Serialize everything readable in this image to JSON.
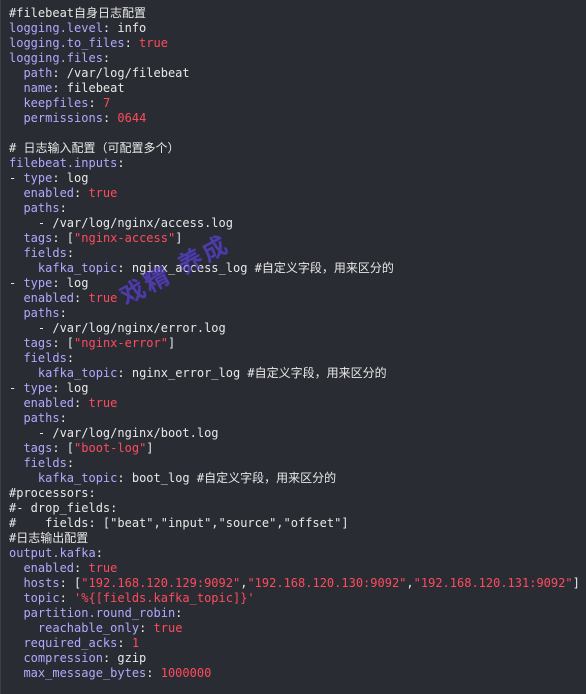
{
  "colors": {
    "background": "#2a2c33",
    "key": "#b2a8ff",
    "text": "#e8e8e8",
    "literal_red": "#ff4b5c",
    "watermark": "#6a4cff"
  },
  "lines": [
    {
      "segments": [
        {
          "t": "#filebeat自身日志配置",
          "s": "c"
        }
      ]
    },
    {
      "segments": [
        {
          "t": "logging.level",
          "s": "k"
        },
        {
          "t": ": info",
          "s": "p"
        }
      ]
    },
    {
      "segments": [
        {
          "t": "logging.to_files",
          "s": "k"
        },
        {
          "t": ": ",
          "s": "p"
        },
        {
          "t": "true",
          "s": "r"
        }
      ]
    },
    {
      "segments": [
        {
          "t": "logging.files",
          "s": "k"
        },
        {
          "t": ":",
          "s": "p"
        }
      ]
    },
    {
      "segments": [
        {
          "t": "  ",
          "s": "p"
        },
        {
          "t": "path",
          "s": "k"
        },
        {
          "t": ": /var/log/filebeat",
          "s": "p"
        }
      ]
    },
    {
      "segments": [
        {
          "t": "  ",
          "s": "p"
        },
        {
          "t": "name",
          "s": "k"
        },
        {
          "t": ": filebeat",
          "s": "p"
        }
      ]
    },
    {
      "segments": [
        {
          "t": "  ",
          "s": "p"
        },
        {
          "t": "keepfiles",
          "s": "k"
        },
        {
          "t": ": ",
          "s": "p"
        },
        {
          "t": "7",
          "s": "r"
        }
      ]
    },
    {
      "segments": [
        {
          "t": "  ",
          "s": "p"
        },
        {
          "t": "permissions",
          "s": "k"
        },
        {
          "t": ": ",
          "s": "p"
        },
        {
          "t": "0644",
          "s": "r"
        }
      ]
    },
    {
      "segments": [
        {
          "t": "",
          "s": "p"
        }
      ]
    },
    {
      "segments": [
        {
          "t": "# 日志输入配置（可配置多个）",
          "s": "c"
        }
      ]
    },
    {
      "segments": [
        {
          "t": "filebeat.inputs",
          "s": "k"
        },
        {
          "t": ":",
          "s": "p"
        }
      ]
    },
    {
      "segments": [
        {
          "t": "- ",
          "s": "p"
        },
        {
          "t": "type",
          "s": "k"
        },
        {
          "t": ": log",
          "s": "p"
        }
      ]
    },
    {
      "segments": [
        {
          "t": "  ",
          "s": "p"
        },
        {
          "t": "enabled",
          "s": "k"
        },
        {
          "t": ": ",
          "s": "p"
        },
        {
          "t": "true",
          "s": "r"
        }
      ]
    },
    {
      "segments": [
        {
          "t": "  ",
          "s": "p"
        },
        {
          "t": "paths",
          "s": "k"
        },
        {
          "t": ":",
          "s": "p"
        }
      ]
    },
    {
      "segments": [
        {
          "t": "    - /var/log/nginx/access.log",
          "s": "p"
        }
      ]
    },
    {
      "segments": [
        {
          "t": "  ",
          "s": "p"
        },
        {
          "t": "tags",
          "s": "k"
        },
        {
          "t": ": [",
          "s": "p"
        },
        {
          "t": "\"nginx-access\"",
          "s": "r"
        },
        {
          "t": "]",
          "s": "p"
        }
      ]
    },
    {
      "segments": [
        {
          "t": "  ",
          "s": "p"
        },
        {
          "t": "fields",
          "s": "k"
        },
        {
          "t": ":",
          "s": "p"
        }
      ]
    },
    {
      "segments": [
        {
          "t": "    ",
          "s": "p"
        },
        {
          "t": "kafka_topic",
          "s": "k"
        },
        {
          "t": ": nginx_access_log #自定义字段，用来区分的",
          "s": "p"
        }
      ]
    },
    {
      "segments": [
        {
          "t": "- ",
          "s": "p"
        },
        {
          "t": "type",
          "s": "k"
        },
        {
          "t": ": log",
          "s": "p"
        }
      ]
    },
    {
      "segments": [
        {
          "t": "  ",
          "s": "p"
        },
        {
          "t": "enabled",
          "s": "k"
        },
        {
          "t": ": ",
          "s": "p"
        },
        {
          "t": "true",
          "s": "r"
        }
      ]
    },
    {
      "segments": [
        {
          "t": "  ",
          "s": "p"
        },
        {
          "t": "paths",
          "s": "k"
        },
        {
          "t": ":",
          "s": "p"
        }
      ]
    },
    {
      "segments": [
        {
          "t": "    - /var/log/nginx/error.log",
          "s": "p"
        }
      ]
    },
    {
      "segments": [
        {
          "t": "  ",
          "s": "p"
        },
        {
          "t": "tags",
          "s": "k"
        },
        {
          "t": ": [",
          "s": "p"
        },
        {
          "t": "\"nginx-error\"",
          "s": "r"
        },
        {
          "t": "]",
          "s": "p"
        }
      ]
    },
    {
      "segments": [
        {
          "t": "  ",
          "s": "p"
        },
        {
          "t": "fields",
          "s": "k"
        },
        {
          "t": ":",
          "s": "p"
        }
      ]
    },
    {
      "segments": [
        {
          "t": "    ",
          "s": "p"
        },
        {
          "t": "kafka_topic",
          "s": "k"
        },
        {
          "t": ": nginx_error_log #自定义字段，用来区分的",
          "s": "p"
        }
      ]
    },
    {
      "segments": [
        {
          "t": "- ",
          "s": "p"
        },
        {
          "t": "type",
          "s": "k"
        },
        {
          "t": ": log",
          "s": "p"
        }
      ]
    },
    {
      "segments": [
        {
          "t": "  ",
          "s": "p"
        },
        {
          "t": "enabled",
          "s": "k"
        },
        {
          "t": ": ",
          "s": "p"
        },
        {
          "t": "true",
          "s": "r"
        }
      ]
    },
    {
      "segments": [
        {
          "t": "  ",
          "s": "p"
        },
        {
          "t": "paths",
          "s": "k"
        },
        {
          "t": ":",
          "s": "p"
        }
      ]
    },
    {
      "segments": [
        {
          "t": "    - /var/log/nginx/boot.log",
          "s": "p"
        }
      ]
    },
    {
      "segments": [
        {
          "t": "  ",
          "s": "p"
        },
        {
          "t": "tags",
          "s": "k"
        },
        {
          "t": ": [",
          "s": "p"
        },
        {
          "t": "\"boot-log\"",
          "s": "r"
        },
        {
          "t": "]",
          "s": "p"
        }
      ]
    },
    {
      "segments": [
        {
          "t": "  ",
          "s": "p"
        },
        {
          "t": "fields",
          "s": "k"
        },
        {
          "t": ":",
          "s": "p"
        }
      ]
    },
    {
      "segments": [
        {
          "t": "    ",
          "s": "p"
        },
        {
          "t": "kafka_topic",
          "s": "k"
        },
        {
          "t": ": boot_log #自定义字段，用来区分的",
          "s": "p"
        }
      ]
    },
    {
      "segments": [
        {
          "t": "#processors:",
          "s": "c"
        }
      ]
    },
    {
      "segments": [
        {
          "t": "#- drop_fields:",
          "s": "c"
        }
      ]
    },
    {
      "segments": [
        {
          "t": "#    fields: [\"beat\",\"input\",\"source\",\"offset\"]",
          "s": "c"
        }
      ]
    },
    {
      "segments": [
        {
          "t": "#日志输出配置",
          "s": "c"
        }
      ]
    },
    {
      "segments": [
        {
          "t": "output.kafka",
          "s": "k"
        },
        {
          "t": ":",
          "s": "p"
        }
      ]
    },
    {
      "segments": [
        {
          "t": "  ",
          "s": "p"
        },
        {
          "t": "enabled",
          "s": "k"
        },
        {
          "t": ": ",
          "s": "p"
        },
        {
          "t": "true",
          "s": "r"
        }
      ]
    },
    {
      "segments": [
        {
          "t": "  ",
          "s": "p"
        },
        {
          "t": "hosts",
          "s": "k"
        },
        {
          "t": ": [",
          "s": "p"
        },
        {
          "t": "\"192.168.120.129:9092\"",
          "s": "r"
        },
        {
          "t": ",",
          "s": "p"
        },
        {
          "t": "\"192.168.120.130:9092\"",
          "s": "r"
        },
        {
          "t": ",",
          "s": "p"
        },
        {
          "t": "\"192.168.120.131:9092\"",
          "s": "r"
        },
        {
          "t": "]",
          "s": "p"
        }
      ]
    },
    {
      "segments": [
        {
          "t": "  ",
          "s": "p"
        },
        {
          "t": "topic",
          "s": "k"
        },
        {
          "t": ": ",
          "s": "p"
        },
        {
          "t": "'%{[fields.kafka_topic]}'",
          "s": "r"
        }
      ]
    },
    {
      "segments": [
        {
          "t": "  ",
          "s": "p"
        },
        {
          "t": "partition.round_robin",
          "s": "k"
        },
        {
          "t": ":",
          "s": "p"
        }
      ]
    },
    {
      "segments": [
        {
          "t": "    ",
          "s": "p"
        },
        {
          "t": "reachable_only",
          "s": "k"
        },
        {
          "t": ": ",
          "s": "p"
        },
        {
          "t": "true",
          "s": "r"
        }
      ]
    },
    {
      "segments": [
        {
          "t": "  ",
          "s": "p"
        },
        {
          "t": "required_acks",
          "s": "k"
        },
        {
          "t": ": ",
          "s": "p"
        },
        {
          "t": "1",
          "s": "r"
        }
      ]
    },
    {
      "segments": [
        {
          "t": "  ",
          "s": "p"
        },
        {
          "t": "compression",
          "s": "k"
        },
        {
          "t": ": gzip",
          "s": "p"
        }
      ]
    },
    {
      "segments": [
        {
          "t": "  ",
          "s": "p"
        },
        {
          "t": "max_message_bytes",
          "s": "k"
        },
        {
          "t": ": ",
          "s": "p"
        },
        {
          "t": "1000000",
          "s": "r"
        }
      ]
    }
  ],
  "watermark": {
    "text": "戏精 养成"
  }
}
